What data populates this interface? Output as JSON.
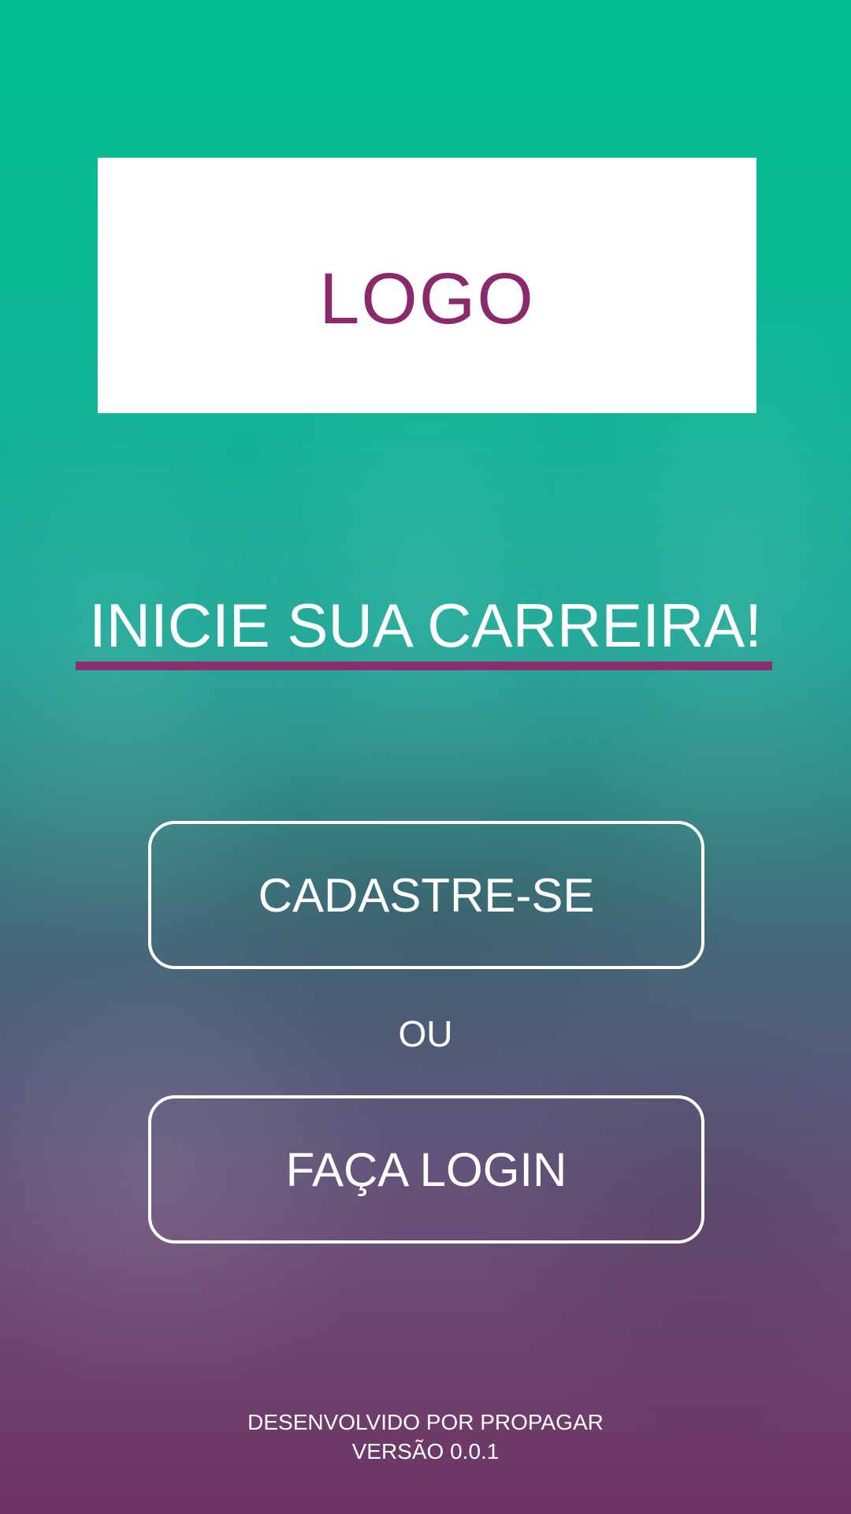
{
  "logo": {
    "text": "LOGO"
  },
  "headline": {
    "text": "INICIE SUA CARREIRA!"
  },
  "actions": {
    "signup_label": "CADASTRE-SE",
    "separator": "OU",
    "login_label": "FAÇA LOGIN"
  },
  "footer": {
    "developer": "DESENVOLVIDO POR PROPAGAR",
    "version": "VERSÃO 0.0.1"
  },
  "colors": {
    "accent": "#8b2d6e",
    "gradient_top": "#00bd8f",
    "gradient_bottom": "#6b3363",
    "text": "#ffffff"
  }
}
